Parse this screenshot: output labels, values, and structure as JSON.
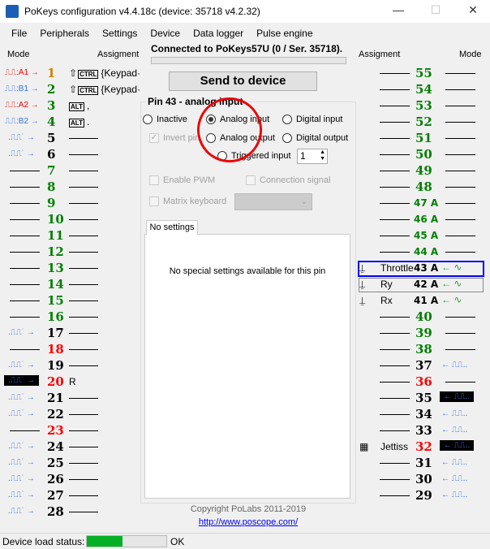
{
  "window": {
    "title": "PoKeys configuration v4.4.18c (device: 35718 v4.2.32)",
    "minimize": "—",
    "maximize": "☐",
    "close": "✕"
  },
  "menu": [
    "File",
    "Peripherals",
    "Settings",
    "Device",
    "Data logger",
    "Pulse engine"
  ],
  "headers": {
    "mode": "Mode",
    "assignment": "Assigment"
  },
  "status": "Connected to PoKeys57U (0 / Ser. 35718).",
  "send_button": "Send to device",
  "pin_panel": {
    "title": "Pin 43 - analog input",
    "radios": [
      {
        "label": "Inactive",
        "checked": false
      },
      {
        "label": "Analog input",
        "checked": true
      },
      {
        "label": "Digital input",
        "checked": false
      },
      {
        "label": "Analog output",
        "checked": false
      },
      {
        "label": "Digital output",
        "checked": false
      },
      {
        "label": "Triggered input",
        "checked": false
      }
    ],
    "invert_pin": "Invert pin",
    "trigger_value": "1",
    "enable_pwm": "Enable PWM",
    "connection_signal": "Connection signal",
    "matrix_keyboard": "Matrix keyboard",
    "tab": "No settings",
    "no_settings": "No special settings available for this pin"
  },
  "copyright": "Copyright PoLabs 2011-2019",
  "link": "http://www.poscope.com/",
  "statusbar": {
    "label": "Device load status:",
    "progress": 0.45,
    "progress_color": "#06b025",
    "value": "OK"
  },
  "colors": {
    "green": "#008000",
    "red": "#ff0000",
    "black": "#000000",
    "mode_blue": "#3a6fe6",
    "analog_green": "#2a9a3a"
  },
  "left_pins": [
    {
      "pin": "1",
      "color": "orange",
      "mode": "encoder",
      "mode_text": "A1 →",
      "mode_color": "red",
      "assign": "{Keypad·",
      "keys": [
        "⇧",
        "CTRL"
      ]
    },
    {
      "pin": "2",
      "color": "green",
      "mode": "encoder",
      "mode_text": "B1 →",
      "mode_color": "blue",
      "assign": "{Keypad·",
      "keys": [
        "⇧",
        "CTRL"
      ]
    },
    {
      "pin": "3",
      "color": "green",
      "mode": "encoder",
      "mode_text": "A2 →",
      "mode_color": "red",
      "assign": ",",
      "keys": [
        "ALT"
      ]
    },
    {
      "pin": "4",
      "color": "green",
      "mode": "encoder",
      "mode_text": "B2 →",
      "mode_color": "blue",
      "assign": ".",
      "keys": [
        "ALT"
      ]
    },
    {
      "pin": "5",
      "color": "black",
      "mode": "input"
    },
    {
      "pin": "6",
      "color": "black",
      "mode": "input"
    },
    {
      "pin": "7",
      "color": "green"
    },
    {
      "pin": "8",
      "color": "green"
    },
    {
      "pin": "9",
      "color": "green"
    },
    {
      "pin": "10",
      "color": "green"
    },
    {
      "pin": "11",
      "color": "green"
    },
    {
      "pin": "12",
      "color": "green"
    },
    {
      "pin": "13",
      "color": "green"
    },
    {
      "pin": "14",
      "color": "green"
    },
    {
      "pin": "15",
      "color": "green"
    },
    {
      "pin": "16",
      "color": "green"
    },
    {
      "pin": "17",
      "color": "black",
      "mode": "input"
    },
    {
      "pin": "18",
      "color": "red"
    },
    {
      "pin": "19",
      "color": "black",
      "mode": "input"
    },
    {
      "pin": "20",
      "color": "red",
      "mode": "input-selected",
      "assign": "R"
    },
    {
      "pin": "21",
      "color": "black",
      "mode": "input"
    },
    {
      "pin": "22",
      "color": "black",
      "mode": "input"
    },
    {
      "pin": "23",
      "color": "red"
    },
    {
      "pin": "24",
      "color": "black",
      "mode": "input"
    },
    {
      "pin": "25",
      "color": "black",
      "mode": "input"
    },
    {
      "pin": "26",
      "color": "black",
      "mode": "input"
    },
    {
      "pin": "27",
      "color": "black",
      "mode": "input"
    },
    {
      "pin": "28",
      "color": "black",
      "mode": "input"
    }
  ],
  "right_pins": [
    {
      "pin": "55",
      "color": "green"
    },
    {
      "pin": "54",
      "color": "green"
    },
    {
      "pin": "53",
      "color": "green"
    },
    {
      "pin": "52",
      "color": "green"
    },
    {
      "pin": "51",
      "color": "green"
    },
    {
      "pin": "50",
      "color": "green"
    },
    {
      "pin": "49",
      "color": "green"
    },
    {
      "pin": "48",
      "color": "green"
    },
    {
      "pin": "47 A",
      "color": "green"
    },
    {
      "pin": "46 A",
      "color": "green"
    },
    {
      "pin": "45 A",
      "color": "green"
    },
    {
      "pin": "44 A",
      "color": "green"
    },
    {
      "pin": "43 A",
      "color": "black",
      "mode": "analog",
      "assign": "Throttle",
      "icon": "joystick"
    },
    {
      "pin": "42 A",
      "color": "black",
      "mode": "analog",
      "assign": "Ry",
      "icon": "joystick"
    },
    {
      "pin": "41 A",
      "color": "black",
      "mode": "analog",
      "assign": "Rx",
      "icon": "joystick"
    },
    {
      "pin": "40",
      "color": "green"
    },
    {
      "pin": "39",
      "color": "green"
    },
    {
      "pin": "38",
      "color": "green"
    },
    {
      "pin": "37",
      "color": "black",
      "mode": "input"
    },
    {
      "pin": "36",
      "color": "red"
    },
    {
      "pin": "35",
      "color": "black",
      "mode": "input-selected"
    },
    {
      "pin": "34",
      "color": "black",
      "mode": "input"
    },
    {
      "pin": "33",
      "color": "black",
      "mode": "input"
    },
    {
      "pin": "32",
      "color": "red",
      "mode": "input-selected",
      "assign": "Jettiss",
      "icon": "keyboard"
    },
    {
      "pin": "31",
      "color": "black",
      "mode": "input"
    },
    {
      "pin": "30",
      "color": "black",
      "mode": "input"
    },
    {
      "pin": "29",
      "color": "black",
      "mode": "input"
    }
  ]
}
